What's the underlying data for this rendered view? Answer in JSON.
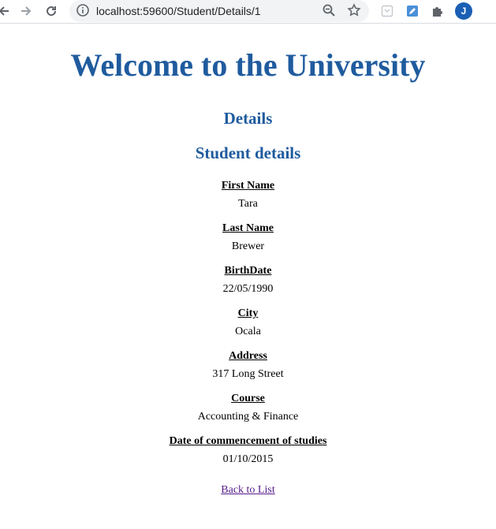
{
  "browser": {
    "url": "localhost:59600/Student/Details/1",
    "avatar_letter": "J"
  },
  "page": {
    "heading": "Welcome to the University",
    "subheading": "Details",
    "section_title": "Student details",
    "fields": [
      {
        "label": "First Name",
        "value": "Tara"
      },
      {
        "label": "Last Name",
        "value": "Brewer"
      },
      {
        "label": "BirthDate",
        "value": "22/05/1990"
      },
      {
        "label": "City",
        "value": "Ocala"
      },
      {
        "label": "Address",
        "value": "317 Long Street"
      },
      {
        "label": "Course",
        "value": "Accounting & Finance"
      },
      {
        "label": "Date of commencement of studies",
        "value": "01/10/2015"
      }
    ],
    "back_link": "Back to List"
  },
  "colors": {
    "heading": "#1f5b9e",
    "link_visited": "#551a8b"
  }
}
